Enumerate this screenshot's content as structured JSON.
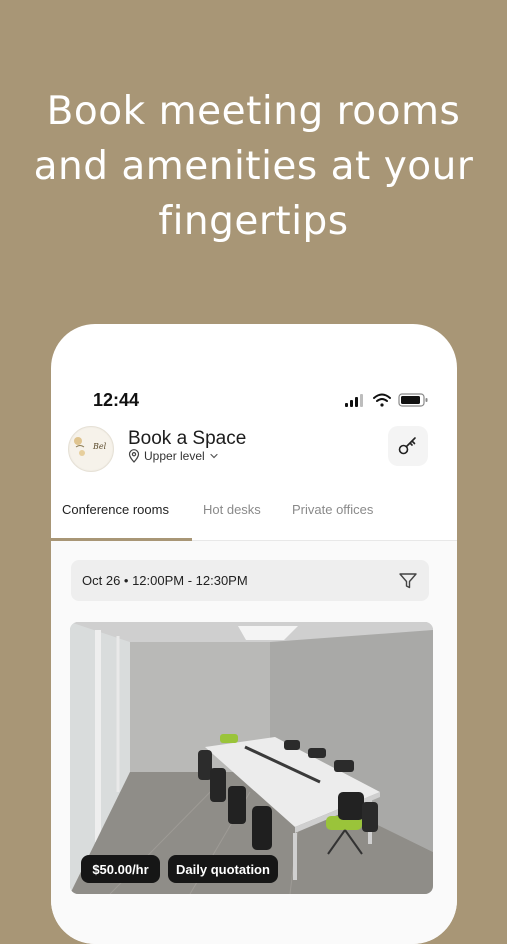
{
  "headline": {
    "line1": "Book meeting rooms",
    "line2": "and amenities at your",
    "line3": "fingertips"
  },
  "status_bar": {
    "time": "12:44",
    "icons": [
      "signal-icon",
      "wifi-icon",
      "battery-icon"
    ]
  },
  "header": {
    "logo_text": "Bel",
    "title": "Book a Space",
    "location": "Upper level",
    "location_icon": "location-pin-icon",
    "action_icon": "key-icon"
  },
  "tabs": [
    {
      "label": "Conference rooms",
      "active": true
    },
    {
      "label": "Hot desks",
      "active": false
    },
    {
      "label": "Private offices",
      "active": false
    }
  ],
  "filter": {
    "label": "Oct 26 • 12:00PM - 12:30PM",
    "icon": "filter-icon"
  },
  "room": {
    "price": "$50.00/hr",
    "quote_label": "Daily quotation"
  },
  "colors": {
    "background": "#a89676",
    "accent": "#a89676",
    "pill": "#161616"
  }
}
